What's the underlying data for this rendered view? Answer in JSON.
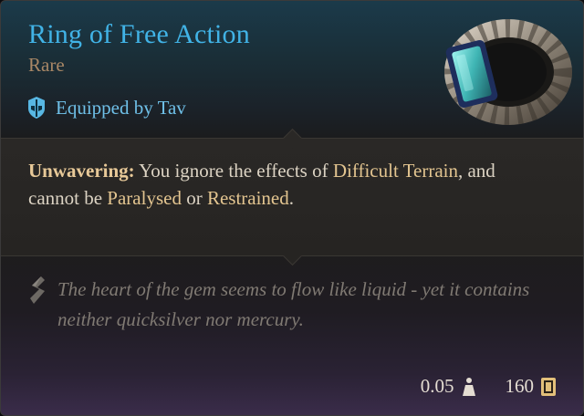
{
  "item": {
    "name": "Ring of Free Action",
    "rarity": "Rare",
    "equipped_by": "Equipped by Tav",
    "equipped_icon": "helm-icon",
    "art_icon": "ring-icon"
  },
  "description": {
    "part1_bold": "Unwavering:",
    "part2": " You ignore the effects of ",
    "kw1": "Difficult Terrain",
    "part3": ", and cannot be ",
    "kw2": "Paralysed",
    "part4": " or ",
    "kw3": "Restrained",
    "part5": "."
  },
  "flavor": {
    "icon": "quill-icon",
    "text": "The heart of the gem seems to flow like liquid - yet it contains neither quicksilver nor mercury."
  },
  "footer": {
    "weight": "0.05",
    "weight_icon": "weight-icon",
    "value": "160",
    "value_icon": "gold-icon"
  },
  "colors": {
    "name": "#41b3e6",
    "rarity": "#a88766",
    "equipped": "#6fc0e8",
    "keyword": "#e3c590",
    "flavor": "#807a73"
  }
}
